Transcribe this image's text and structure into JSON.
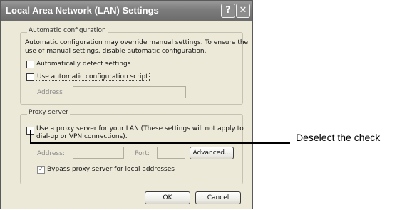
{
  "dialog": {
    "title": "Local Area Network (LAN) Settings",
    "help_glyph": "?",
    "close_glyph": "✕"
  },
  "auto_config": {
    "legend": "Automatic configuration",
    "description_line1": "Automatic configuration may override manual settings.  To ensure the",
    "description_line2": "use of manual settings, disable automatic configuration.",
    "detect_label": "Automatically detect settings",
    "detect_checked": false,
    "script_label": "Use automatic configuration script",
    "script_checked": false,
    "address_label": "Address",
    "address_value": ""
  },
  "proxy": {
    "legend": "Proxy server",
    "use_proxy_line1": "Use a proxy server for your LAN (These settings will not apply to",
    "use_proxy_line2": "dial-up or VPN connections).",
    "use_proxy_checked": false,
    "address_label": "Address:",
    "address_value": "",
    "port_label": "Port:",
    "port_value": "",
    "advanced_label": "Advanced...",
    "bypass_label": "Bypass proxy server for local addresses",
    "bypass_checked": true,
    "check_glyph": "✓"
  },
  "buttons": {
    "ok": "OK",
    "cancel": "Cancel"
  },
  "annotation": {
    "text": "Deselect the check"
  }
}
